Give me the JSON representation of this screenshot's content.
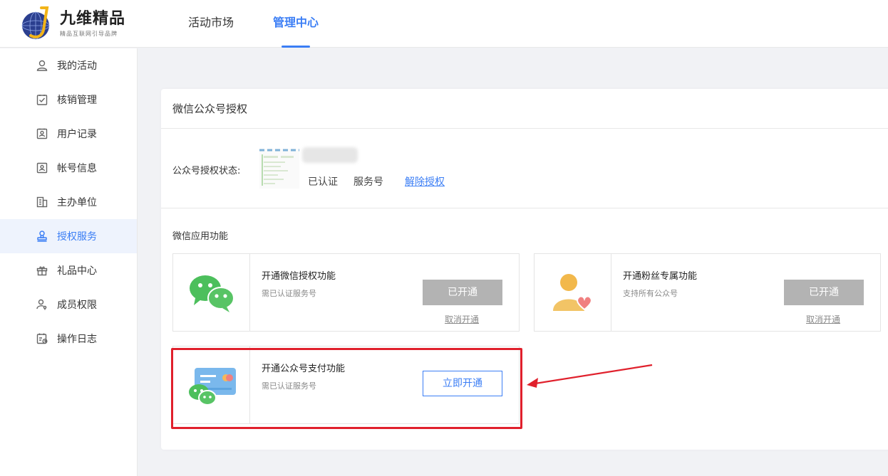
{
  "brand": {
    "name": "九维精品",
    "tagline": "精品互联网引导品牌",
    "logo_letter": "J",
    "logo_icon": "globe-j-icon"
  },
  "top_nav": {
    "items": [
      {
        "label": "活动市场",
        "active": false
      },
      {
        "label": "管理中心",
        "active": true
      }
    ]
  },
  "sidebar": {
    "items": [
      {
        "label": "我的活动",
        "icon": "user-icon",
        "active": false
      },
      {
        "label": "核销管理",
        "icon": "clipboard-check-icon",
        "active": false
      },
      {
        "label": "用户记录",
        "icon": "user-card-icon",
        "active": false
      },
      {
        "label": "帐号信息",
        "icon": "id-card-icon",
        "active": false
      },
      {
        "label": "主办单位",
        "icon": "building-icon",
        "active": false
      },
      {
        "label": "授权服务",
        "icon": "stamp-icon",
        "active": true
      },
      {
        "label": "礼品中心",
        "icon": "gift-icon",
        "active": false
      },
      {
        "label": "成员权限",
        "icon": "user-key-icon",
        "active": false
      },
      {
        "label": "操作日志",
        "icon": "calendar-log-icon",
        "active": false
      }
    ]
  },
  "panel": {
    "title": "微信公众号授权",
    "auth": {
      "label": "公众号授权状态:",
      "status": "已认证",
      "type": "服务号",
      "revoke_link": "解除授权"
    },
    "section_title": "微信应用功能",
    "features": [
      {
        "title": "开通微信授权功能",
        "desc": "需已认证服务号",
        "button": "已开通",
        "cancel": "取消开通",
        "icon": "wechat-icon"
      },
      {
        "title": "开通粉丝专属功能",
        "desc": "支持所有公众号",
        "button": "已开通",
        "cancel": "取消开通",
        "icon": "fan-heart-icon"
      },
      {
        "title": "开通公众号支付功能",
        "desc": "需已认证服务号",
        "button": "立即开通",
        "icon": "wechat-pay-card-icon"
      }
    ]
  },
  "colors": {
    "accent": "#3b7ef5",
    "disabled_button": "#b3b3b3",
    "highlight": "#e0202c",
    "wechat_green": "#4cbf5c"
  }
}
